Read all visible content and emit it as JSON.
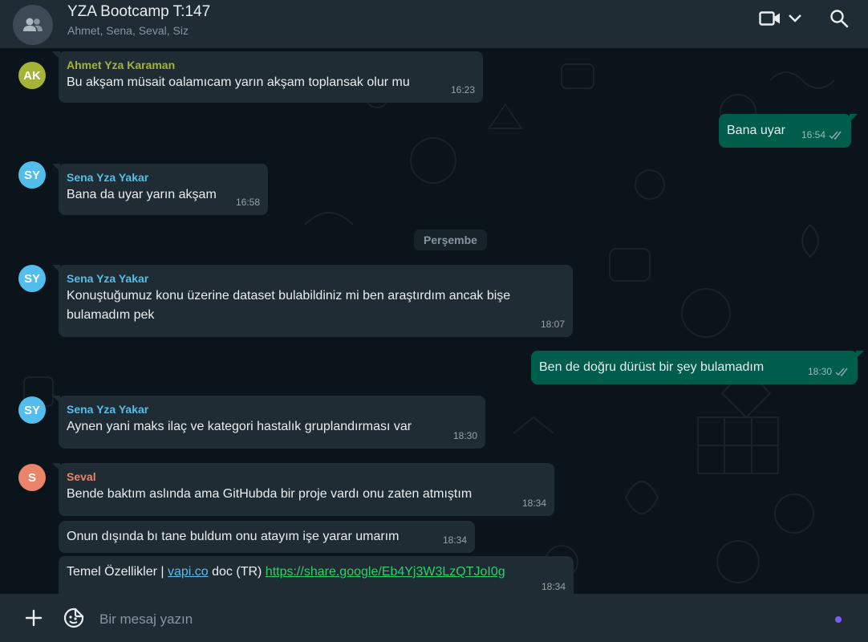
{
  "header": {
    "title": "YZA Bootcamp T:147",
    "members": "Ahmet, Sena, Seval, Siz"
  },
  "date_divider": "Perşembe",
  "messages": [
    {
      "sender": "Ahmet Yza Karaman",
      "initials": "AK",
      "text": "Bu akşam müsait oalamıcam yarın akşam toplansak olur mu",
      "time": "16:23"
    },
    {
      "text": "Bana uyar",
      "time": "16:54"
    },
    {
      "sender": "Sena Yza Yakar",
      "initials": "SY",
      "text": "Bana da uyar yarın akşam",
      "time": "16:58"
    },
    {
      "sender": "Sena Yza Yakar",
      "initials": "SY",
      "text_line1": "Konuştuğumuz konu üzerine dataset bulabildiniz mi ben araştırdım ancak bişe",
      "text_line2": "bulamadım pek",
      "time": "18:07"
    },
    {
      "text": "Ben de doğru dürüst bir şey bulamadım",
      "time": "18:30"
    },
    {
      "sender": "Sena Yza Yakar",
      "initials": "SY",
      "text": "Aynen yani maks ilaç ve kategori hastalık gruplandırması var",
      "time": "18:30"
    },
    {
      "sender": "Seval",
      "initials": "S",
      "text": "Bende baktım aslında ama GitHubda bir proje vardı onu zaten atmıştım",
      "time": "18:34"
    },
    {
      "text": "Onun dışında bı tane buldum onu atayım işe yarar umarım",
      "time": "18:34"
    },
    {
      "text_prefix": "Temel Özellikler | ",
      "link1": "vapi.co",
      "text_mid": " doc (TR) ",
      "link2": "https://share.google/Eb4Yj3W3LzQTJoI0g",
      "time": "18:34"
    }
  ],
  "composer": {
    "placeholder": "Bir mesaj yazın"
  },
  "colors": {
    "ahmet": "#a5b337",
    "sena": "#53bdeb",
    "seval": "#e9836a",
    "outgoing": "#005c4b",
    "incoming": "#202c33"
  },
  "icons": [
    "group-icon",
    "video-call-icon",
    "chevron-down-icon",
    "search-icon",
    "double-check-icon",
    "plus-icon",
    "sticker-icon"
  ]
}
